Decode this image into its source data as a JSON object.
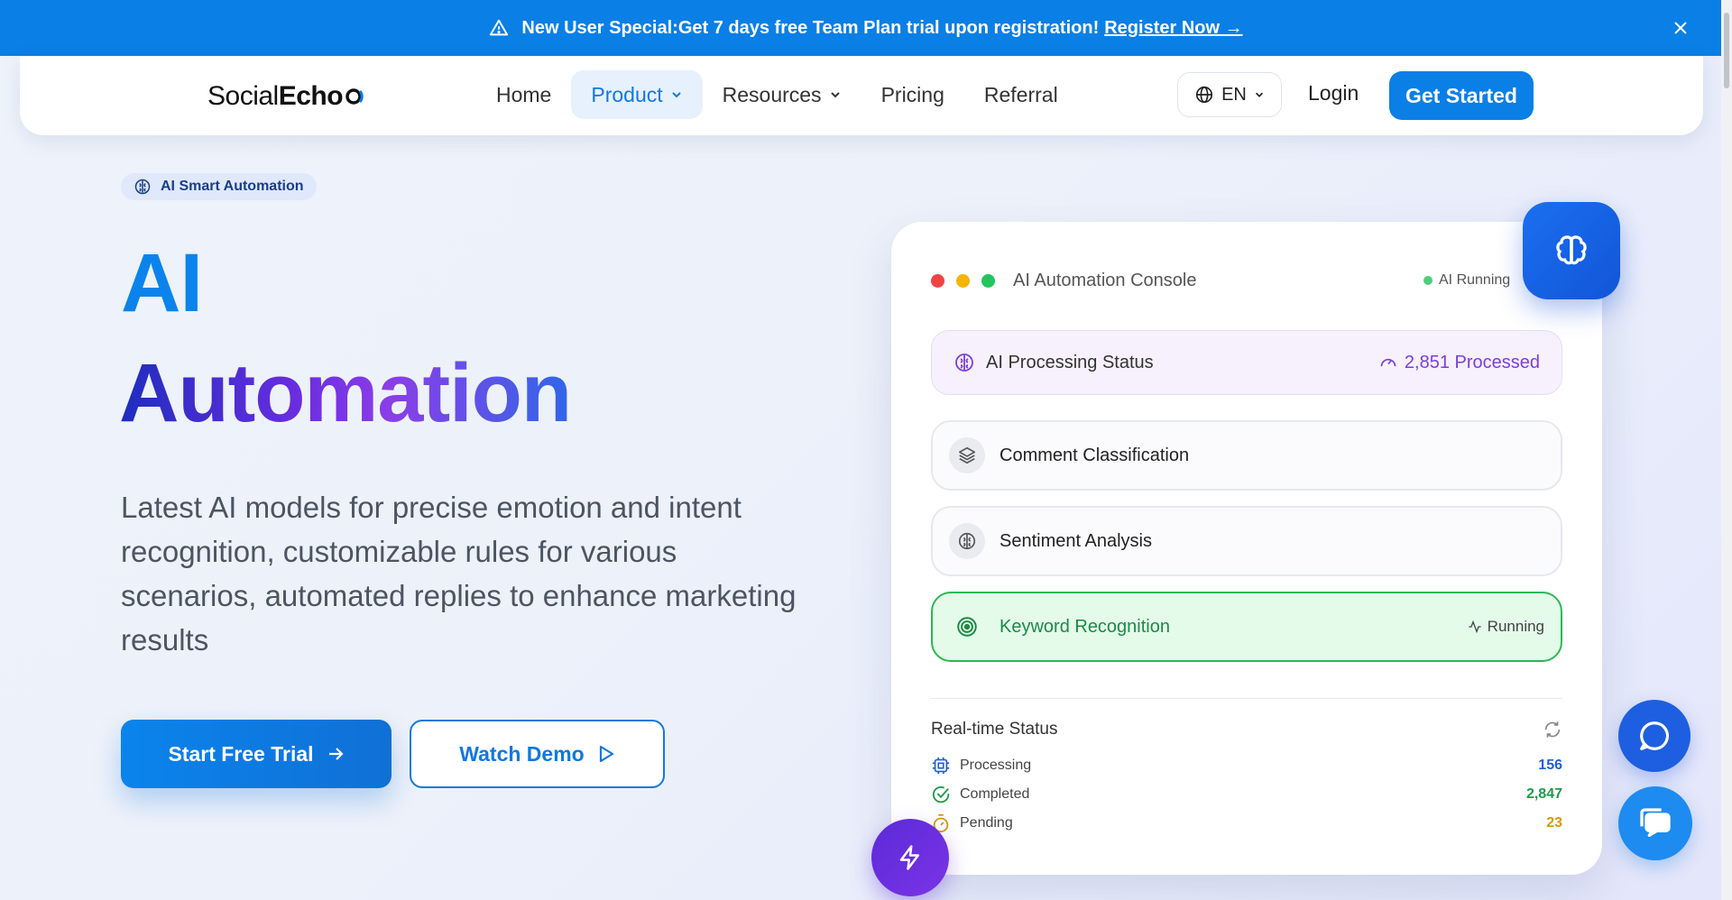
{
  "announcement": {
    "message": "New User Special:Get 7 days free Team Plan trial upon registration!",
    "link": "Register Now →"
  },
  "nav": {
    "logo_social": "Social",
    "logo_echo": "Echo",
    "links": [
      "Home",
      "Product",
      "Resources",
      "Pricing",
      "Referral"
    ],
    "lang": "EN",
    "login": "Login",
    "get_started": "Get Started"
  },
  "hero": {
    "badge": "AI Smart Automation",
    "title_line1": "AI",
    "title_line2": "Automation",
    "description": "Latest AI models for precise emotion and intent recognition, customizable rules for various scenarios, automated replies to enhance marketing results",
    "trial_button": "Start Free Trial",
    "demo_button": "Watch Demo"
  },
  "console": {
    "title": "AI Automation Console",
    "ai_running": "AI Running",
    "status_label": "AI Processing Status",
    "processed": "2,851 Processed",
    "tasks": [
      {
        "label": "Comment Classification"
      },
      {
        "label": "Sentiment Analysis"
      },
      {
        "label": "Keyword Recognition",
        "status": "Running"
      }
    ],
    "realtime_title": "Real-time Status",
    "realtime": [
      {
        "label": "Processing",
        "value": "156",
        "color": "#1f5fd6"
      },
      {
        "label": "Completed",
        "value": "2,847",
        "color": "#1f9a4c"
      },
      {
        "label": "Pending",
        "value": "23",
        "color": "#d99a0c"
      }
    ]
  },
  "colors": {
    "primary": "#0a7fe6",
    "accent_purple": "#7e3ce0",
    "success": "#2bb856"
  }
}
